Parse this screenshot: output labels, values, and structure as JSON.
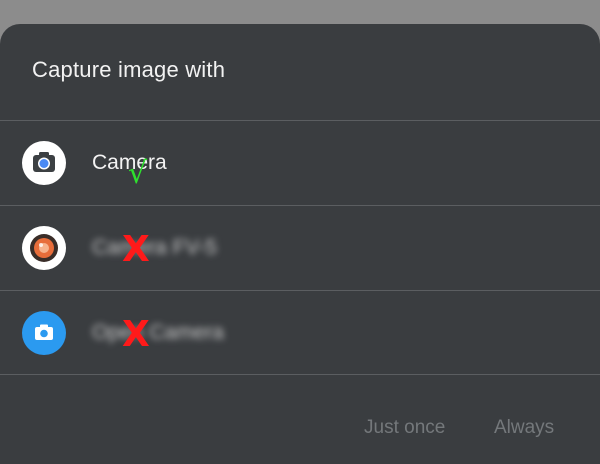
{
  "dialog": {
    "title": "Capture image with"
  },
  "apps": [
    {
      "label": "Camera",
      "icon": "google-camera-icon",
      "mark": "√",
      "mark_color": "#2ee02e",
      "blurred": false
    },
    {
      "label": "Camera FV-5",
      "icon": "camera-fv5-icon",
      "mark": "X",
      "mark_color": "#ff1a1a",
      "blurred": true
    },
    {
      "label": "Open Camera",
      "icon": "open-camera-icon",
      "mark": "X",
      "mark_color": "#ff1a1a",
      "blurred": true
    }
  ],
  "actions": {
    "just_once": "Just once",
    "always": "Always"
  },
  "colors": {
    "sheet": "#3a3d40",
    "divider": "#5b5e61",
    "scrim": "#8c8c8c",
    "action_text": "#74787b"
  }
}
